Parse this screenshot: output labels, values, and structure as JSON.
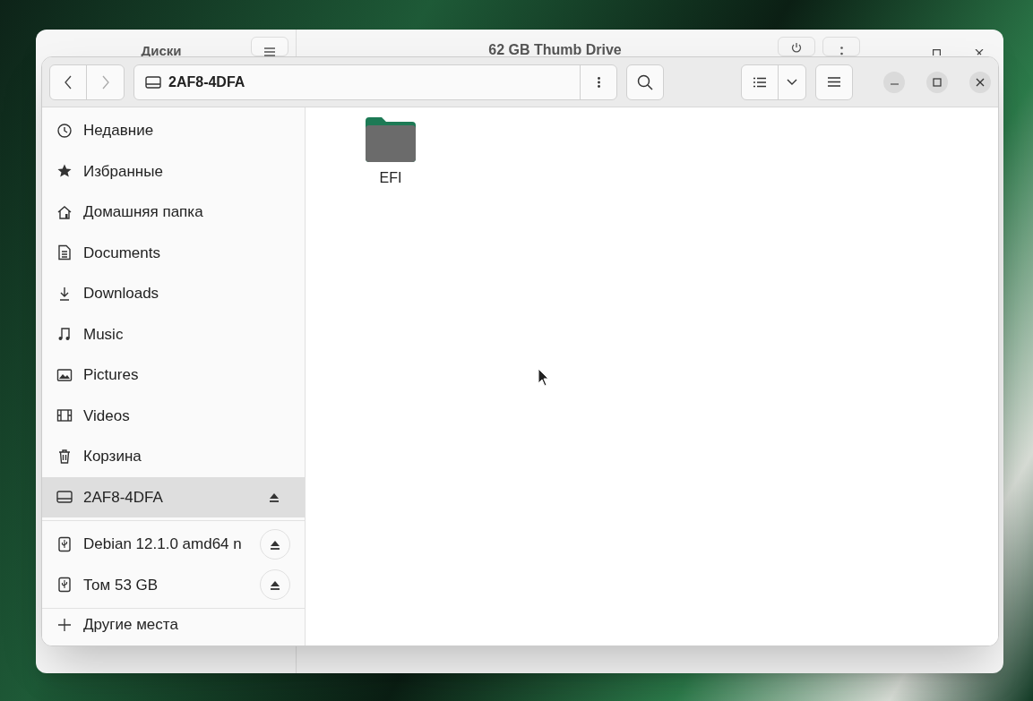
{
  "back_window": {
    "title": "Диски",
    "drive_title": "62 GB Thumb Drive"
  },
  "header": {
    "path": "2AF8-4DFA"
  },
  "sidebar": {
    "items": [
      {
        "label": "Недавние",
        "kind": "place",
        "selected": false
      },
      {
        "label": "Избранные",
        "kind": "place",
        "selected": false
      },
      {
        "label": "Домашняя папка",
        "kind": "place",
        "selected": false
      },
      {
        "label": "Documents",
        "kind": "place",
        "selected": false
      },
      {
        "label": "Downloads",
        "kind": "place",
        "selected": false
      },
      {
        "label": "Music",
        "kind": "place",
        "selected": false
      },
      {
        "label": "Pictures",
        "kind": "place",
        "selected": false
      },
      {
        "label": "Videos",
        "kind": "place",
        "selected": false
      },
      {
        "label": "Корзина",
        "kind": "place",
        "selected": false
      },
      {
        "label": "2AF8-4DFA",
        "kind": "mount",
        "selected": true
      },
      {
        "label": "Debian 12.1.0 amd64 n",
        "kind": "device",
        "selected": false
      },
      {
        "label": "Том 53 GB",
        "kind": "device",
        "selected": false
      },
      {
        "label": "Другие места",
        "kind": "action",
        "selected": false
      }
    ]
  },
  "files": [
    {
      "name": "EFI",
      "selected": false
    }
  ]
}
